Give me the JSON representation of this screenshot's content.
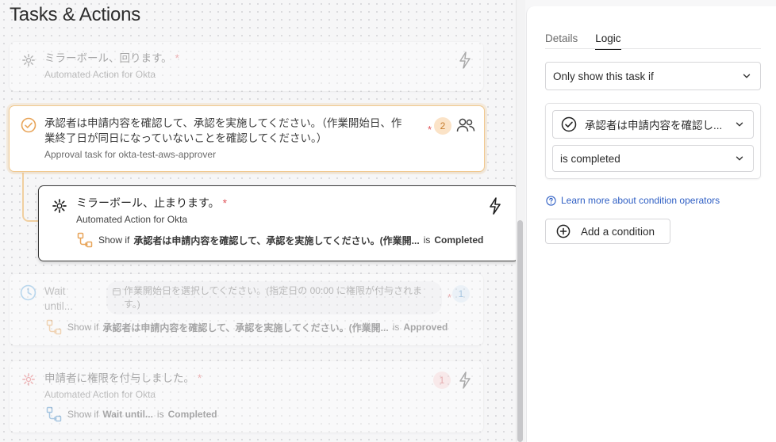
{
  "page_title": "Tasks & Actions",
  "cards": [
    {
      "title": "ミラーボール、回ります。",
      "required": "*",
      "subtitle": "Automated Action for Okta",
      "icon": "sparkle-icon",
      "action_icon": "lightning-icon"
    },
    {
      "title_line1": "承認者は申請内容を確認して、承認を実施してください。（作業開始日、作",
      "title_line2": "業終了日が同日になっていないことを確認してください。）",
      "required": "*",
      "subtitle": "Approval task for okta-test-aws-approver",
      "badge": "2",
      "icon": "check-circle-icon",
      "action_icon": "people-icon"
    },
    {
      "title": "ミラーボール、止まります。",
      "required": "*",
      "subtitle": "Automated Action for Okta",
      "condition": {
        "show_if": "Show if",
        "task": "承認者は申請内容を確認して、承認を実施してください。(作業開...",
        "is": "is",
        "state": "Completed"
      },
      "icon": "sparkle-icon",
      "action_icon": "lightning-icon"
    },
    {
      "title_line1": "Wait",
      "title_line2": "until...",
      "field_placeholder_line1": "作業開始日を選択してください。(指定日の 00:00 に権限が付与されま",
      "field_placeholder_line2": "す。)",
      "required": "*",
      "badge": "1",
      "condition": {
        "show_if": "Show if",
        "task": "承認者は申請内容を確認して、承認を実施してください。(作業開...",
        "is": "is",
        "state": "Approved"
      },
      "icon": "clock-icon"
    },
    {
      "title": "申請者に権限を付与しました。",
      "required": "*",
      "subtitle": "Automated Action for Okta",
      "badge": "1",
      "condition": {
        "show_if": "Show if",
        "task": "Wait until...",
        "is": "is",
        "state": "Completed"
      },
      "icon": "sparkle-icon",
      "action_icon": "lightning-icon"
    }
  ],
  "panel": {
    "tabs": [
      "Details",
      "Logic"
    ],
    "active_tab": "Logic",
    "visibility_select": "Only show this task if",
    "condition_task_select": "承認者は申請内容を確認し...",
    "condition_operator_select": "is completed",
    "learn_more_link": "Learn more about condition operators",
    "add_condition_button": "Add a condition"
  },
  "colors": {
    "accent_orange": "#e8a55a",
    "required_red": "#e0565b",
    "link_blue": "#2f5fc4",
    "clock_blue": "#6aaee0"
  }
}
